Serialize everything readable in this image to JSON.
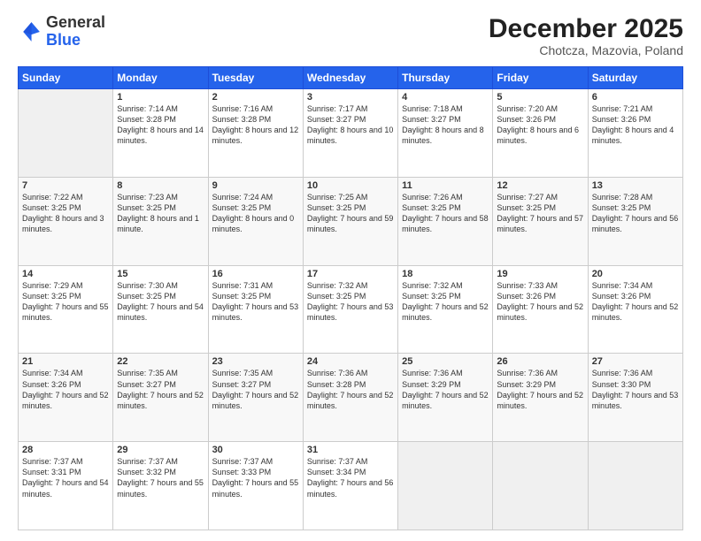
{
  "header": {
    "logo_general": "General",
    "logo_blue": "Blue",
    "month_title": "December 2025",
    "subtitle": "Chotcza, Mazovia, Poland"
  },
  "weekdays": [
    "Sunday",
    "Monday",
    "Tuesday",
    "Wednesday",
    "Thursday",
    "Friday",
    "Saturday"
  ],
  "weeks": [
    [
      {
        "day": "",
        "sunrise": "",
        "sunset": "",
        "daylight": ""
      },
      {
        "day": "1",
        "sunrise": "Sunrise: 7:14 AM",
        "sunset": "Sunset: 3:28 PM",
        "daylight": "Daylight: 8 hours and 14 minutes."
      },
      {
        "day": "2",
        "sunrise": "Sunrise: 7:16 AM",
        "sunset": "Sunset: 3:28 PM",
        "daylight": "Daylight: 8 hours and 12 minutes."
      },
      {
        "day": "3",
        "sunrise": "Sunrise: 7:17 AM",
        "sunset": "Sunset: 3:27 PM",
        "daylight": "Daylight: 8 hours and 10 minutes."
      },
      {
        "day": "4",
        "sunrise": "Sunrise: 7:18 AM",
        "sunset": "Sunset: 3:27 PM",
        "daylight": "Daylight: 8 hours and 8 minutes."
      },
      {
        "day": "5",
        "sunrise": "Sunrise: 7:20 AM",
        "sunset": "Sunset: 3:26 PM",
        "daylight": "Daylight: 8 hours and 6 minutes."
      },
      {
        "day": "6",
        "sunrise": "Sunrise: 7:21 AM",
        "sunset": "Sunset: 3:26 PM",
        "daylight": "Daylight: 8 hours and 4 minutes."
      }
    ],
    [
      {
        "day": "7",
        "sunrise": "Sunrise: 7:22 AM",
        "sunset": "Sunset: 3:25 PM",
        "daylight": "Daylight: 8 hours and 3 minutes."
      },
      {
        "day": "8",
        "sunrise": "Sunrise: 7:23 AM",
        "sunset": "Sunset: 3:25 PM",
        "daylight": "Daylight: 8 hours and 1 minute."
      },
      {
        "day": "9",
        "sunrise": "Sunrise: 7:24 AM",
        "sunset": "Sunset: 3:25 PM",
        "daylight": "Daylight: 8 hours and 0 minutes."
      },
      {
        "day": "10",
        "sunrise": "Sunrise: 7:25 AM",
        "sunset": "Sunset: 3:25 PM",
        "daylight": "Daylight: 7 hours and 59 minutes."
      },
      {
        "day": "11",
        "sunrise": "Sunrise: 7:26 AM",
        "sunset": "Sunset: 3:25 PM",
        "daylight": "Daylight: 7 hours and 58 minutes."
      },
      {
        "day": "12",
        "sunrise": "Sunrise: 7:27 AM",
        "sunset": "Sunset: 3:25 PM",
        "daylight": "Daylight: 7 hours and 57 minutes."
      },
      {
        "day": "13",
        "sunrise": "Sunrise: 7:28 AM",
        "sunset": "Sunset: 3:25 PM",
        "daylight": "Daylight: 7 hours and 56 minutes."
      }
    ],
    [
      {
        "day": "14",
        "sunrise": "Sunrise: 7:29 AM",
        "sunset": "Sunset: 3:25 PM",
        "daylight": "Daylight: 7 hours and 55 minutes."
      },
      {
        "day": "15",
        "sunrise": "Sunrise: 7:30 AM",
        "sunset": "Sunset: 3:25 PM",
        "daylight": "Daylight: 7 hours and 54 minutes."
      },
      {
        "day": "16",
        "sunrise": "Sunrise: 7:31 AM",
        "sunset": "Sunset: 3:25 PM",
        "daylight": "Daylight: 7 hours and 53 minutes."
      },
      {
        "day": "17",
        "sunrise": "Sunrise: 7:32 AM",
        "sunset": "Sunset: 3:25 PM",
        "daylight": "Daylight: 7 hours and 53 minutes."
      },
      {
        "day": "18",
        "sunrise": "Sunrise: 7:32 AM",
        "sunset": "Sunset: 3:25 PM",
        "daylight": "Daylight: 7 hours and 52 minutes."
      },
      {
        "day": "19",
        "sunrise": "Sunrise: 7:33 AM",
        "sunset": "Sunset: 3:26 PM",
        "daylight": "Daylight: 7 hours and 52 minutes."
      },
      {
        "day": "20",
        "sunrise": "Sunrise: 7:34 AM",
        "sunset": "Sunset: 3:26 PM",
        "daylight": "Daylight: 7 hours and 52 minutes."
      }
    ],
    [
      {
        "day": "21",
        "sunrise": "Sunrise: 7:34 AM",
        "sunset": "Sunset: 3:26 PM",
        "daylight": "Daylight: 7 hours and 52 minutes."
      },
      {
        "day": "22",
        "sunrise": "Sunrise: 7:35 AM",
        "sunset": "Sunset: 3:27 PM",
        "daylight": "Daylight: 7 hours and 52 minutes."
      },
      {
        "day": "23",
        "sunrise": "Sunrise: 7:35 AM",
        "sunset": "Sunset: 3:27 PM",
        "daylight": "Daylight: 7 hours and 52 minutes."
      },
      {
        "day": "24",
        "sunrise": "Sunrise: 7:36 AM",
        "sunset": "Sunset: 3:28 PM",
        "daylight": "Daylight: 7 hours and 52 minutes."
      },
      {
        "day": "25",
        "sunrise": "Sunrise: 7:36 AM",
        "sunset": "Sunset: 3:29 PM",
        "daylight": "Daylight: 7 hours and 52 minutes."
      },
      {
        "day": "26",
        "sunrise": "Sunrise: 7:36 AM",
        "sunset": "Sunset: 3:29 PM",
        "daylight": "Daylight: 7 hours and 52 minutes."
      },
      {
        "day": "27",
        "sunrise": "Sunrise: 7:36 AM",
        "sunset": "Sunset: 3:30 PM",
        "daylight": "Daylight: 7 hours and 53 minutes."
      }
    ],
    [
      {
        "day": "28",
        "sunrise": "Sunrise: 7:37 AM",
        "sunset": "Sunset: 3:31 PM",
        "daylight": "Daylight: 7 hours and 54 minutes."
      },
      {
        "day": "29",
        "sunrise": "Sunrise: 7:37 AM",
        "sunset": "Sunset: 3:32 PM",
        "daylight": "Daylight: 7 hours and 55 minutes."
      },
      {
        "day": "30",
        "sunrise": "Sunrise: 7:37 AM",
        "sunset": "Sunset: 3:33 PM",
        "daylight": "Daylight: 7 hours and 55 minutes."
      },
      {
        "day": "31",
        "sunrise": "Sunrise: 7:37 AM",
        "sunset": "Sunset: 3:34 PM",
        "daylight": "Daylight: 7 hours and 56 minutes."
      },
      {
        "day": "",
        "sunrise": "",
        "sunset": "",
        "daylight": ""
      },
      {
        "day": "",
        "sunrise": "",
        "sunset": "",
        "daylight": ""
      },
      {
        "day": "",
        "sunrise": "",
        "sunset": "",
        "daylight": ""
      }
    ]
  ]
}
